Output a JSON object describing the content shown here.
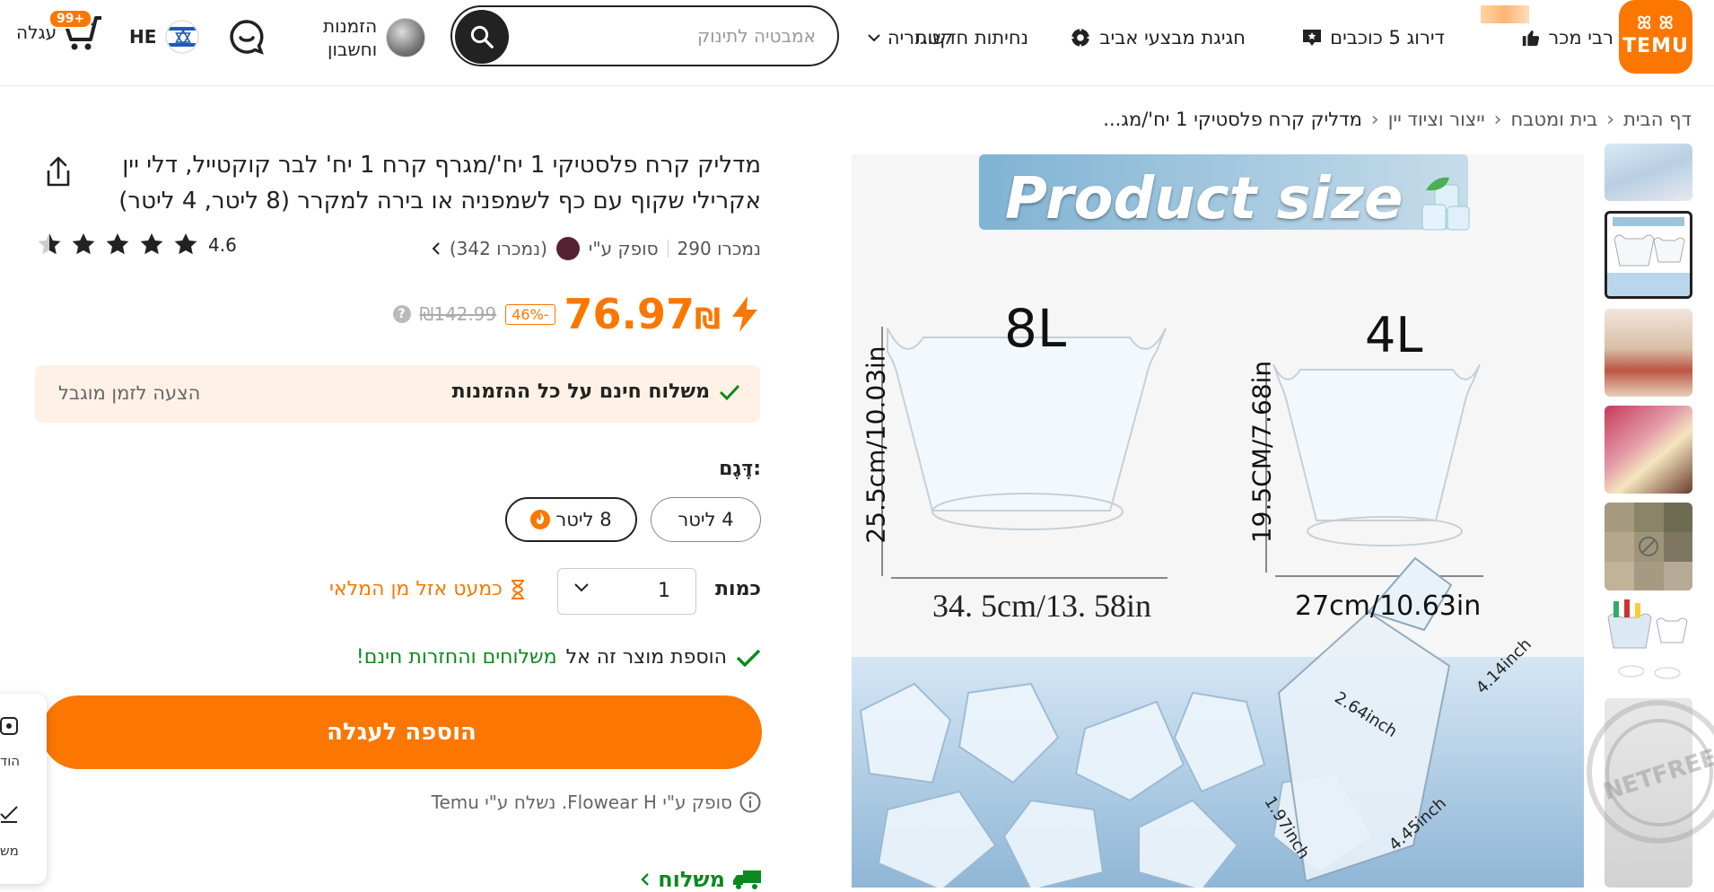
{
  "header": {
    "logo_symbol": "ꕤ ꕤ",
    "logo_word": "TEMU",
    "nav": [
      {
        "label": "רבי מכר"
      },
      {
        "label": "דירוג 5 כוכבים"
      },
      {
        "label": "חגיגת מבצעי אביב"
      },
      {
        "label": "נחיתות חדשות"
      },
      {
        "label": "קטגוריה"
      }
    ],
    "search_placeholder": "אמבטיה לתינוק",
    "account_line1": "הזמנות",
    "account_line2": "וחשבון",
    "lang": "HE",
    "cart_label": "עגלה",
    "cart_badge": "99+"
  },
  "breadcrumb": [
    "דף הבית",
    "בית ומטבח",
    "ייצור וציוד יין",
    "מדליק קרח פלסטיקי 1 יח'/מג..."
  ],
  "image": {
    "banner_text": "Product size",
    "big_label": "8L",
    "small_label": "4L",
    "big_height": "25.5cm/10.03in",
    "small_height": "19.5CM/7.68in",
    "big_width": "34. 5cm/13. 58in",
    "small_width": "27cm/10.63in",
    "scoop_1": "2.64inch",
    "scoop_2": "4.14inch",
    "scoop_3": "1.97inch",
    "scoop_4": "4.45inch"
  },
  "product": {
    "title": "מדליק קרח פלסטיקי 1 יח'/מגרף קרח 1 יח' לבר קוקטייל, דלי יין אקרילי שקוף עם כף לשמפניה או בירה למקרר (8 ליטר, 4 ליטר)",
    "sold": "נמכרו 290",
    "seller_text": "סופק ע\"י",
    "seller_sold": "(נמכרו 342)",
    "rating": "4.6",
    "stars_filled": 5,
    "price_now": "76.97",
    "currency": "₪",
    "discount": "-46%",
    "price_was": "₪142.99",
    "shipping_free": "משלוח חינם על כל ההזמנות",
    "limited_offer": "הצעה לזמן מוגבל",
    "model_label": "דֶּגֶם:",
    "options": [
      {
        "label": "4 ליטר"
      },
      {
        "label": "8 ליטר"
      }
    ],
    "qty_label": "כמות",
    "qty_value": "1",
    "stock_text": "כמעט אזל מן המלאי",
    "free_return_1": "הוספת מוצר זה אל",
    "free_return_2": "משלוחים והחזרות חינם!",
    "add_to_cart": "הוספה לעגלה",
    "seller_info": "סופק ע\"י Flowear H. נשלח ע\"י Temu",
    "shipping_section": "משלוח"
  },
  "side_widget": {
    "a": "הוד",
    "b": "מש"
  },
  "colors": {
    "brand": "#fb7701",
    "success": "#0a8a1e",
    "offer_bg": "#fff1e6"
  }
}
